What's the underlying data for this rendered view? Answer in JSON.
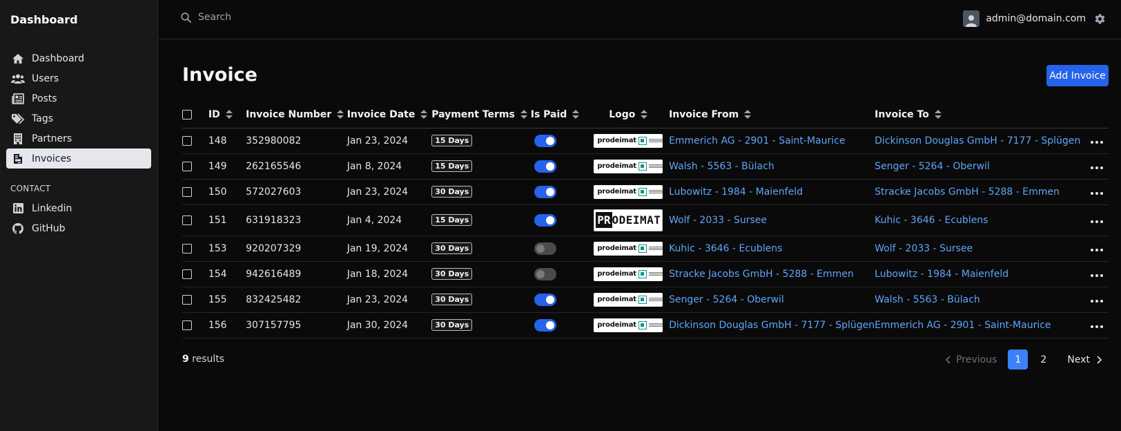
{
  "app": {
    "brand": "Dashboard"
  },
  "sidebar": {
    "items": [
      {
        "label": "Dashboard",
        "icon": "home-icon"
      },
      {
        "label": "Users",
        "icon": "users-icon"
      },
      {
        "label": "Posts",
        "icon": "newspaper-icon"
      },
      {
        "label": "Tags",
        "icon": "tags-icon"
      },
      {
        "label": "Partners",
        "icon": "building-icon"
      },
      {
        "label": "Invoices",
        "icon": "invoice-icon",
        "active": true
      }
    ],
    "section_label": "CONTACT",
    "contact_items": [
      {
        "label": "Linkedin",
        "icon": "linkedin-icon"
      },
      {
        "label": "GitHub",
        "icon": "github-icon"
      }
    ]
  },
  "header": {
    "search_placeholder": "Search",
    "user_email": "admin@domain.com"
  },
  "page": {
    "title": "Invoice",
    "add_button": "Add Invoice"
  },
  "table": {
    "columns": [
      "ID",
      "Invoice Number",
      "Invoice Date",
      "Payment Terms",
      "Is Paid",
      "Logo",
      "Invoice From",
      "Invoice To"
    ],
    "rows": [
      {
        "id": "148",
        "number": "352980082",
        "date": "Jan 23, 2024",
        "terms": "15 Days",
        "paid": true,
        "logo": "small",
        "from": "Emmerich AG - 2901 - Saint-Maurice",
        "to": "Dickinson Douglas GmbH - 7177 - Splügen"
      },
      {
        "id": "149",
        "number": "262165546",
        "date": "Jan 8, 2024",
        "terms": "15 Days",
        "paid": true,
        "logo": "small",
        "from": "Walsh - 5563 - Bülach",
        "to": "Senger - 5264 - Oberwil"
      },
      {
        "id": "150",
        "number": "572027603",
        "date": "Jan 23, 2024",
        "terms": "30 Days",
        "paid": true,
        "logo": "small",
        "from": "Lubowitz - 1984 - Maienfeld",
        "to": "Stracke Jacobs GmbH - 5288 - Emmen"
      },
      {
        "id": "151",
        "number": "631918323",
        "date": "Jan 4, 2024",
        "terms": "15 Days",
        "paid": true,
        "logo": "big",
        "from": "Wolf - 2033 - Sursee",
        "to": "Kuhic - 3646 - Ecublens"
      },
      {
        "id": "153",
        "number": "920207329",
        "date": "Jan 19, 2024",
        "terms": "30 Days",
        "paid": false,
        "logo": "small",
        "from": "Kuhic - 3646 - Ecublens",
        "to": "Wolf - 2033 - Sursee"
      },
      {
        "id": "154",
        "number": "942616489",
        "date": "Jan 18, 2024",
        "terms": "30 Days",
        "paid": false,
        "logo": "small",
        "from": "Stracke Jacobs GmbH - 5288 - Emmen",
        "to": "Lubowitz - 1984 - Maienfeld"
      },
      {
        "id": "155",
        "number": "832425482",
        "date": "Jan 23, 2024",
        "terms": "30 Days",
        "paid": true,
        "logo": "small",
        "from": "Senger - 5264 - Oberwil",
        "to": "Walsh - 5563 - Bülach"
      },
      {
        "id": "156",
        "number": "307157795",
        "date": "Jan 30, 2024",
        "terms": "30 Days",
        "paid": true,
        "logo": "small",
        "from": "Dickinson Douglas GmbH - 7177 - Splügen",
        "to": "Emmerich AG - 2901 - Saint-Maurice"
      }
    ]
  },
  "logo_text": {
    "small": "prodeimat",
    "big_dark": "PR",
    "big_rest": "ODEIMAT"
  },
  "footer": {
    "results_count": "9",
    "results_label": "results",
    "prev_label": "Previous",
    "next_label": "Next",
    "pages": [
      "1",
      "2"
    ],
    "current_page": "1"
  },
  "colors": {
    "accent": "#2563eb",
    "link": "#60a5fa",
    "background": "#0a0a0a",
    "sidebar": "#181818"
  }
}
